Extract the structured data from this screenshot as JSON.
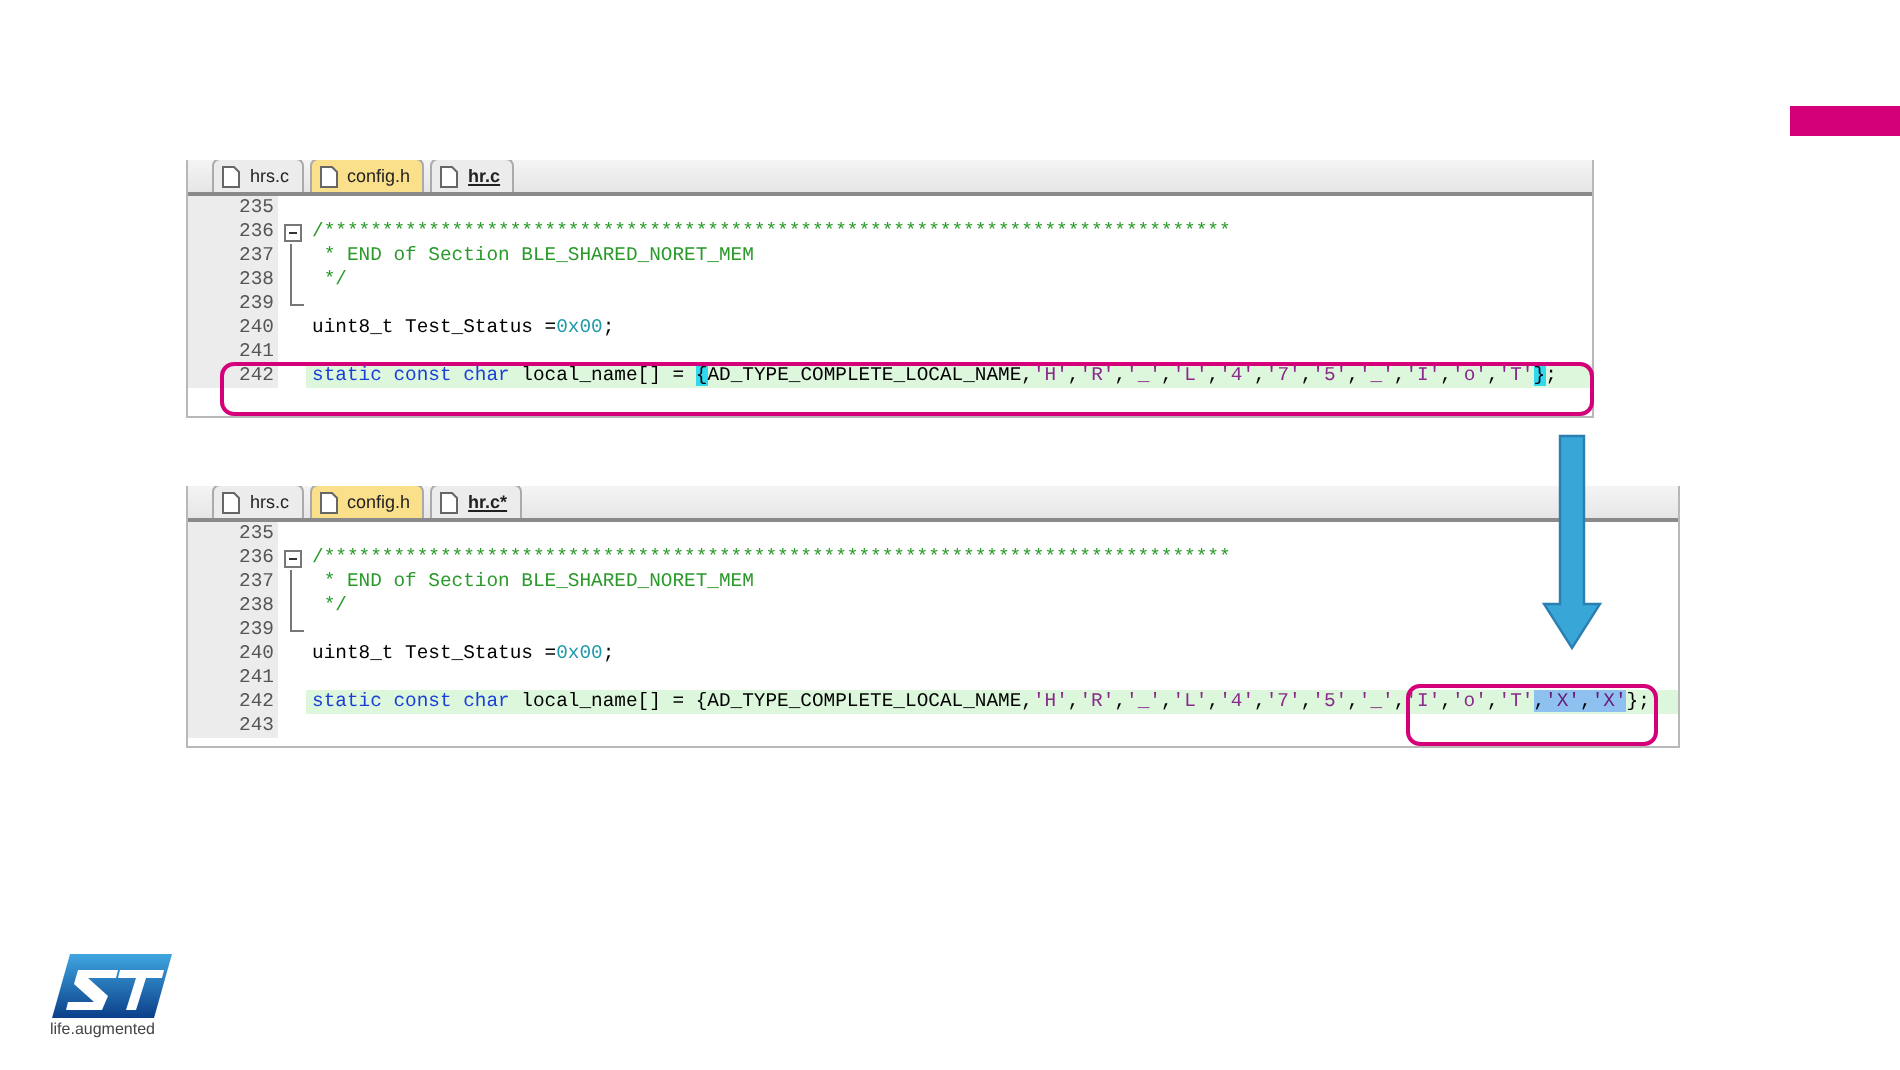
{
  "editors": [
    {
      "tabs": [
        {
          "label": "hrs.c",
          "selected": false,
          "color": "#ececec"
        },
        {
          "label": "config.h",
          "selected": false,
          "color": "#fbe08c"
        },
        {
          "label": "hr.c",
          "selected": true,
          "color": "#ececec"
        }
      ],
      "lines": [
        {
          "number": "235",
          "current": false,
          "kind": "plain"
        },
        {
          "number": "236",
          "current": false,
          "kind": "foldstart",
          "tokens": [
            {
              "text": "/******************************************************************************",
              "kind": "comment"
            }
          ]
        },
        {
          "number": "237",
          "current": false,
          "kind": "foldbody",
          "tokens": [
            {
              "text": " * END of Section BLE_SHARED_NORET_MEM",
              "kind": "comment"
            }
          ]
        },
        {
          "number": "238",
          "current": false,
          "kind": "foldbody",
          "tokens": [
            {
              "text": " */",
              "kind": "comment"
            }
          ]
        },
        {
          "number": "239",
          "current": false,
          "kind": "foldend"
        },
        {
          "number": "240",
          "current": false,
          "kind": "plain",
          "tokens": [
            {
              "text": "uint8_t Test_Status =",
              "kind": "plain"
            },
            {
              "text": "0x00",
              "kind": "number"
            },
            {
              "text": ";",
              "kind": "plain"
            }
          ]
        },
        {
          "number": "241",
          "current": false,
          "kind": "plain"
        },
        {
          "number": "242",
          "current": true,
          "kind": "plain",
          "tokens": [
            {
              "text": "static const char",
              "kind": "keyword"
            },
            {
              "text": " local_name[] = ",
              "kind": "plain"
            },
            {
              "text": "{",
              "kind": "match"
            },
            {
              "text": "AD_TYPE_COMPLETE_LOCAL_NAME,",
              "kind": "plain"
            },
            {
              "text": "'H'",
              "kind": "string"
            },
            {
              "text": ",",
              "kind": "plain"
            },
            {
              "text": "'R'",
              "kind": "string"
            },
            {
              "text": ",",
              "kind": "plain"
            },
            {
              "text": "'_'",
              "kind": "string"
            },
            {
              "text": ",",
              "kind": "plain"
            },
            {
              "text": "'L'",
              "kind": "string"
            },
            {
              "text": ",",
              "kind": "plain"
            },
            {
              "text": "'4'",
              "kind": "string"
            },
            {
              "text": ",",
              "kind": "plain"
            },
            {
              "text": "'7'",
              "kind": "string"
            },
            {
              "text": ",",
              "kind": "plain"
            },
            {
              "text": "'5'",
              "kind": "string"
            },
            {
              "text": ",",
              "kind": "plain"
            },
            {
              "text": "'_'",
              "kind": "string"
            },
            {
              "text": ",",
              "kind": "plain"
            },
            {
              "text": "'I'",
              "kind": "string"
            },
            {
              "text": ",",
              "kind": "plain"
            },
            {
              "text": "'o'",
              "kind": "string"
            },
            {
              "text": ",",
              "kind": "plain"
            },
            {
              "text": "'T'",
              "kind": "string"
            },
            {
              "text": "}",
              "kind": "match"
            },
            {
              "text": ";",
              "kind": "plain"
            }
          ]
        }
      ]
    },
    {
      "tabs": [
        {
          "label": "hrs.c",
          "selected": false,
          "color": "#ececec"
        },
        {
          "label": "config.h",
          "selected": false,
          "color": "#fbe08c"
        },
        {
          "label": "hr.c*",
          "selected": true,
          "color": "#ececec"
        }
      ],
      "lines": [
        {
          "number": "235",
          "current": false,
          "kind": "plain"
        },
        {
          "number": "236",
          "current": false,
          "kind": "foldstart",
          "tokens": [
            {
              "text": "/******************************************************************************",
              "kind": "comment"
            }
          ]
        },
        {
          "number": "237",
          "current": false,
          "kind": "foldbody",
          "tokens": [
            {
              "text": " * END of Section BLE_SHARED_NORET_MEM",
              "kind": "comment"
            }
          ]
        },
        {
          "number": "238",
          "current": false,
          "kind": "foldbody",
          "tokens": [
            {
              "text": " */",
              "kind": "comment"
            }
          ]
        },
        {
          "number": "239",
          "current": false,
          "kind": "foldend"
        },
        {
          "number": "240",
          "current": false,
          "kind": "plain",
          "tokens": [
            {
              "text": "uint8_t Test_Status =",
              "kind": "plain"
            },
            {
              "text": "0x00",
              "kind": "number"
            },
            {
              "text": ";",
              "kind": "plain"
            }
          ]
        },
        {
          "number": "241",
          "current": false,
          "kind": "plain"
        },
        {
          "number": "242",
          "current": true,
          "kind": "plain",
          "tokens": [
            {
              "text": "static const char",
              "kind": "keyword"
            },
            {
              "text": " local_name[] = {AD_TYPE_COMPLETE_LOCAL_NAME,",
              "kind": "plain"
            },
            {
              "text": "'H'",
              "kind": "string"
            },
            {
              "text": ",",
              "kind": "plain"
            },
            {
              "text": "'R'",
              "kind": "string"
            },
            {
              "text": ",",
              "kind": "plain"
            },
            {
              "text": "'_'",
              "kind": "string"
            },
            {
              "text": ",",
              "kind": "plain"
            },
            {
              "text": "'L'",
              "kind": "string"
            },
            {
              "text": ",",
              "kind": "plain"
            },
            {
              "text": "'4'",
              "kind": "string"
            },
            {
              "text": ",",
              "kind": "plain"
            },
            {
              "text": "'7'",
              "kind": "string"
            },
            {
              "text": ",",
              "kind": "plain"
            },
            {
              "text": "'5'",
              "kind": "string"
            },
            {
              "text": ",",
              "kind": "plain"
            },
            {
              "text": "'_'",
              "kind": "string"
            },
            {
              "text": ",",
              "kind": "plain"
            },
            {
              "text": "'I'",
              "kind": "string"
            },
            {
              "text": ",",
              "kind": "plain"
            },
            {
              "text": "'o'",
              "kind": "string"
            },
            {
              "text": ",",
              "kind": "plain"
            },
            {
              "text": "'T'",
              "kind": "string"
            },
            {
              "text": ",",
              "kind": "selplain"
            },
            {
              "text": "'X'",
              "kind": "selstring"
            },
            {
              "text": ",",
              "kind": "selplain"
            },
            {
              "text": "'X'",
              "kind": "selstring"
            },
            {
              "text": "};",
              "kind": "plain"
            }
          ]
        },
        {
          "number": "243",
          "current": false,
          "kind": "plain"
        }
      ]
    }
  ],
  "logo": {
    "tagline": "life.augmented"
  }
}
